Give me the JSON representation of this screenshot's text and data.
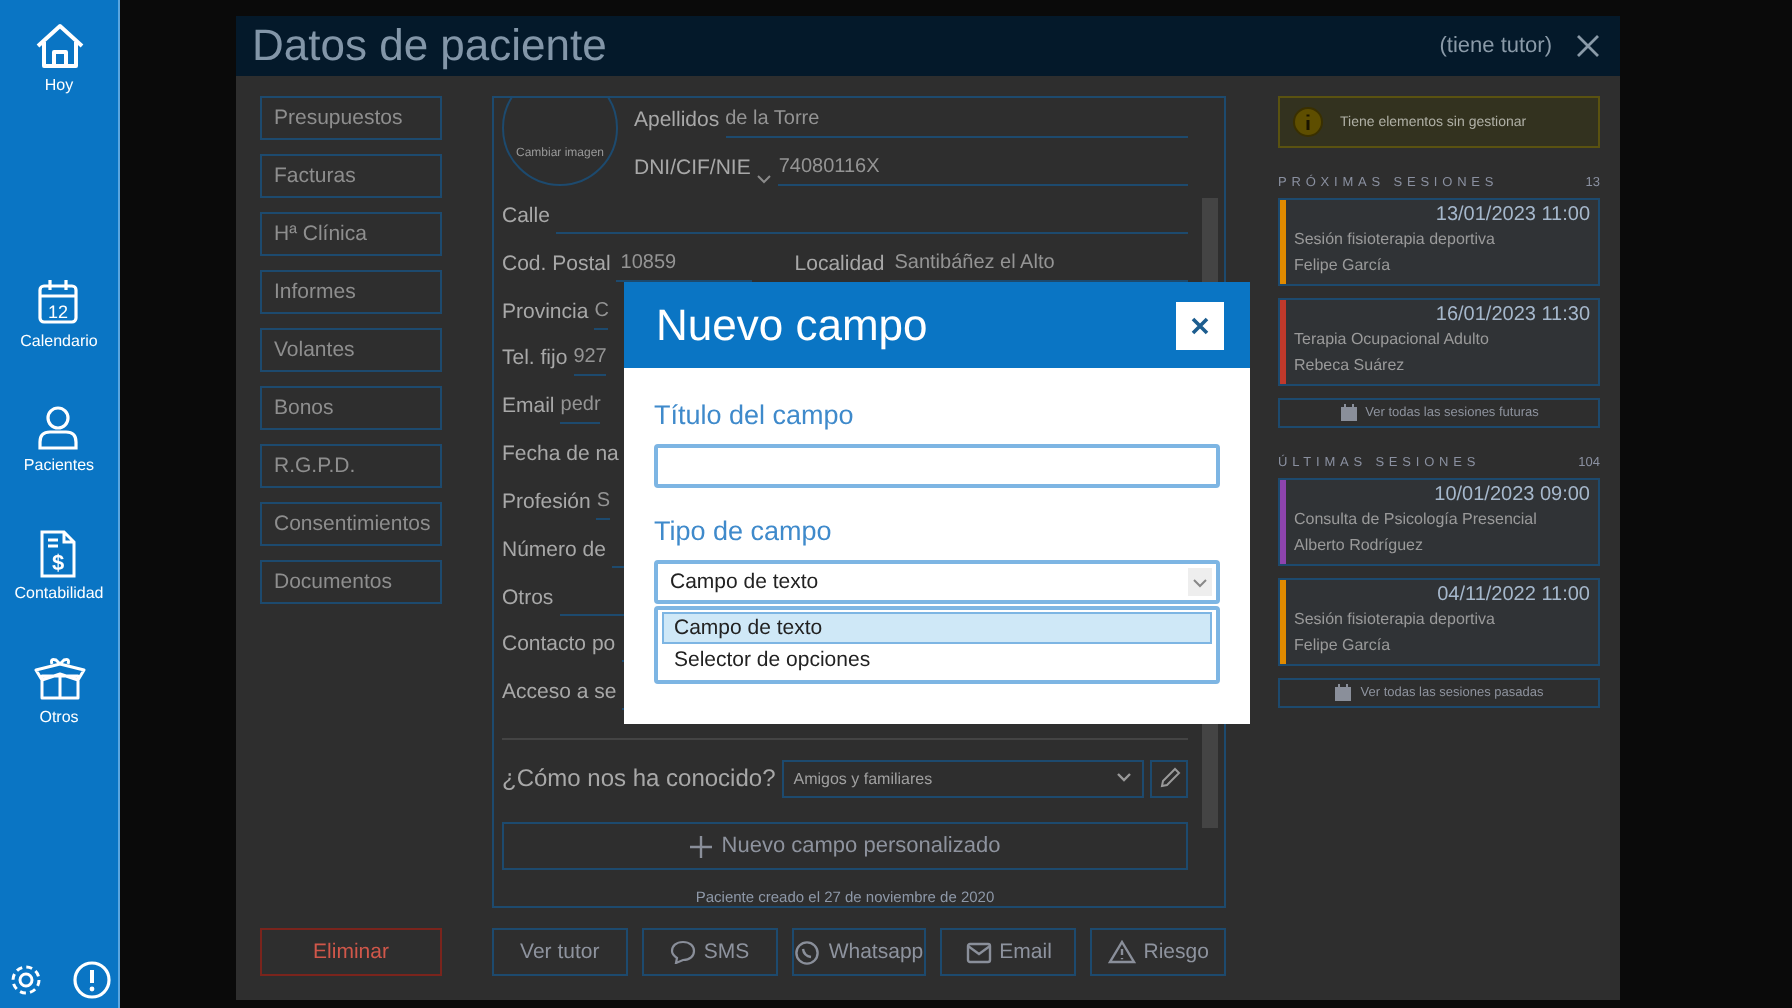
{
  "sidebar": {
    "items": [
      {
        "label": "Hoy"
      },
      {
        "label": "Calendario",
        "icon_text": "12"
      },
      {
        "label": "Pacientes"
      },
      {
        "label": "Contabilidad",
        "icon_text": "$"
      },
      {
        "label": "Otros"
      }
    ]
  },
  "window": {
    "title": "Datos de paciente",
    "tutor_note": "(tiene tutor)"
  },
  "nav_buttons": [
    "Presupuestos",
    "Facturas",
    "Hª Clínica",
    "Informes",
    "Volantes",
    "Bonos",
    "R.G.P.D.",
    "Consentimientos",
    "Documentos"
  ],
  "delete_button": "Eliminar",
  "patient": {
    "photo_label": "Cambiar imagen",
    "surname": {
      "label": "Apellidos",
      "value": "de la Torre"
    },
    "id": {
      "label": "DNI/CIF/NIE",
      "value": "74080116X"
    },
    "rows": [
      [
        {
          "label": "Calle"
        }
      ],
      [
        {
          "label": "Cod. Postal",
          "value": "10859"
        },
        {
          "label": "Localidad",
          "value": "Santibáñez el Alto"
        }
      ],
      [
        {
          "label": "Provincia",
          "value": "C"
        }
      ],
      [
        {
          "label": "Tel. fijo",
          "value": "927"
        }
      ],
      [
        {
          "label": "Email",
          "value": "pedr"
        }
      ],
      [
        {
          "label": "Fecha de na"
        }
      ],
      [
        {
          "label": "Profesión",
          "value": "S"
        }
      ],
      [
        {
          "label": "Número de"
        }
      ],
      [
        {
          "label": "Otros"
        }
      ],
      [
        {
          "label": "Contacto po"
        }
      ],
      [
        {
          "label": "Acceso a se"
        }
      ]
    ],
    "referral": {
      "label": "¿Cómo nos ha conocido?",
      "value": "Amigos y familiares"
    },
    "new_field_button": "Nuevo campo personalizado",
    "created_note": "Paciente creado el 27 de noviembre de 2020"
  },
  "action_buttons": [
    "Ver tutor",
    "SMS",
    "Whatsapp",
    "Email",
    "Riesgo"
  ],
  "alert": "Tiene elementos sin gestionar",
  "session_groups": [
    {
      "title": "PRÓXIMAS SESIONES",
      "count": "13",
      "link": "Ver todas las sesiones futuras",
      "sessions": [
        {
          "datetime": "13/01/2023 11:00",
          "name": "Sesión fisioterapia deportiva",
          "therapist": "Felipe García",
          "color": "#e08a00"
        },
        {
          "datetime": "16/01/2023 11:30",
          "name": "Terapia Ocupacional Adulto",
          "therapist": "Rebeca Suárez",
          "color": "#c0392b"
        }
      ]
    },
    {
      "title": "ÚLTIMAS SESIONES",
      "count": "104",
      "link": "Ver todas las sesiones pasadas",
      "sessions": [
        {
          "datetime": "10/01/2023 09:00",
          "name": "Consulta de Psicología Presencial",
          "therapist": "Alberto Rodríguez",
          "color": "#8e44ad"
        },
        {
          "datetime": "04/11/2022 11:00",
          "name": "Sesión fisioterapia deportiva",
          "therapist": "Felipe García",
          "color": "#e08a00"
        }
      ]
    }
  ],
  "modal": {
    "title": "Nuevo campo",
    "title_label": "Título del campo",
    "type_label": "Tipo de campo",
    "type_value": "Campo de texto",
    "options": [
      {
        "label": "Campo de texto",
        "selected": true
      },
      {
        "label": "Selector de opciones",
        "selected": false
      }
    ]
  }
}
